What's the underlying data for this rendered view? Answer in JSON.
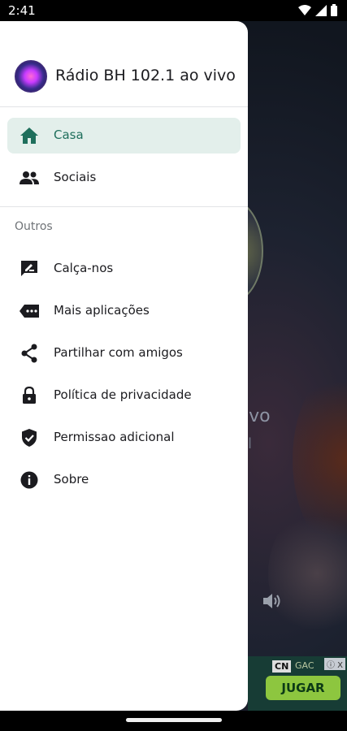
{
  "status_bar": {
    "time": "2:41",
    "icons": [
      "wifi-icon",
      "cell-signal-icon",
      "battery-icon"
    ]
  },
  "background_app": {
    "title_fragment": "ivo",
    "subtitle_fragment": "il",
    "ad": {
      "logo_text": "CN",
      "tag_text": "GAC",
      "button_label": "JUGAR",
      "close_label": "ⓘ X"
    }
  },
  "drawer": {
    "header": {
      "app_title": "Rádio BH 102.1 ao vivo"
    },
    "primary_items": [
      {
        "label": "Casa",
        "icon": "home-icon",
        "active": true
      },
      {
        "label": "Sociais",
        "icon": "people-icon",
        "active": false
      }
    ],
    "section_label": "Outros",
    "other_items": [
      {
        "label": "Calça-nos",
        "icon": "rate-edit-icon"
      },
      {
        "label": "Mais aplicações",
        "icon": "more-apps-icon"
      },
      {
        "label": "Partilhar com amigos",
        "icon": "share-icon"
      },
      {
        "label": "Política de privacidade",
        "icon": "lock-icon"
      },
      {
        "label": "Permissao adicional",
        "icon": "shield-check-icon"
      },
      {
        "label": "Sobre",
        "icon": "info-icon"
      }
    ]
  },
  "colors": {
    "accent": "#1f6f5c",
    "active_bg": "#e3efeb",
    "drawer_bg": "#ffffff"
  }
}
